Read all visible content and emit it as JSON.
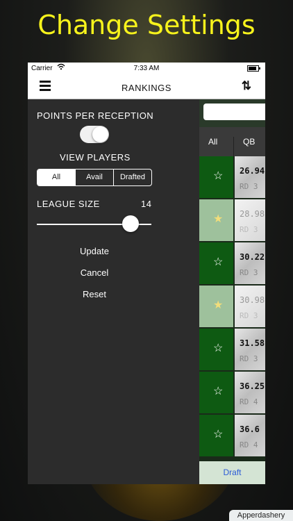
{
  "banner": {
    "title": "Change Settings"
  },
  "status_bar": {
    "carrier": "Carrier",
    "wifi_icon": "wifi-icon",
    "time": "7:33 AM",
    "battery_icon": "battery-icon"
  },
  "nav": {
    "title": "RANKINGS",
    "menu_icon": "hamburger-menu-icon",
    "refresh_icon": "refresh-icon"
  },
  "settings": {
    "ppr_label": "POINTS PER RECEPTION",
    "ppr_enabled": true,
    "view_players_label": "VIEW PLAYERS",
    "view_segments": [
      "All",
      "Avail",
      "Drafted"
    ],
    "view_selected": "All",
    "league_size_label": "LEAGUE SIZE",
    "league_size_value": "14",
    "actions": [
      "Update",
      "Cancel",
      "Reset"
    ]
  },
  "rankings": {
    "positions": [
      "All",
      "QB"
    ],
    "rows": [
      {
        "adp": "26.94",
        "round": "RD 3",
        "drafted": false
      },
      {
        "adp": "28.98",
        "round": "RD 3",
        "drafted": true
      },
      {
        "adp": "30.22",
        "round": "RD 3",
        "drafted": false
      },
      {
        "adp": "30.98",
        "round": "RD 3",
        "drafted": true
      },
      {
        "adp": "31.58",
        "round": "RD 3",
        "drafted": false
      },
      {
        "adp": "36.25",
        "round": "RD 4",
        "drafted": false
      },
      {
        "adp": "36.6",
        "round": "RD 4",
        "drafted": false
      }
    ],
    "draft_button": "Draft"
  },
  "watermark": "Apperdashery",
  "colors": {
    "banner": "#f7f31c",
    "drawer": "#2c2c2c",
    "field_green": "#0e5a12",
    "draft_link": "#2b5bd7"
  }
}
